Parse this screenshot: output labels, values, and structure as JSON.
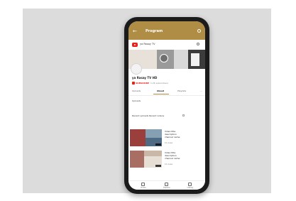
{
  "app": {
    "title": "Program",
    "back_icon": "back-arrow-icon",
    "menu_icon": "menu-icon",
    "accent_color": "#b08d44"
  },
  "channel_bar": {
    "name": "ya Rasay TV",
    "logo_icon": "youtube-logo-icon",
    "search_icon": "search-icon"
  },
  "profile": {
    "name": "ya Rasay TV HD",
    "subscribe_label": "SUBSCRIBE",
    "subscriber_count": "1.2K subscribers"
  },
  "tabs": [
    "Uploads",
    "About",
    "Playlists",
    "..."
  ],
  "filter_label": "Uploads",
  "section": {
    "title": "Recent uploads",
    "subtitle": "Recent videos"
  },
  "videos": [
    {
      "title_line1": "Video title",
      "title_line2": "description",
      "title_line3": "channel name",
      "meta": "1K views"
    },
    {
      "title_line1": "Video title",
      "title_line2": "description",
      "title_line3": "channel name",
      "meta": "1K views"
    }
  ],
  "bottom_nav": [
    {
      "label": "Home",
      "icon": "home-icon"
    },
    {
      "label": "Explore",
      "icon": "explore-icon"
    },
    {
      "label": "Library",
      "icon": "library-icon"
    }
  ]
}
